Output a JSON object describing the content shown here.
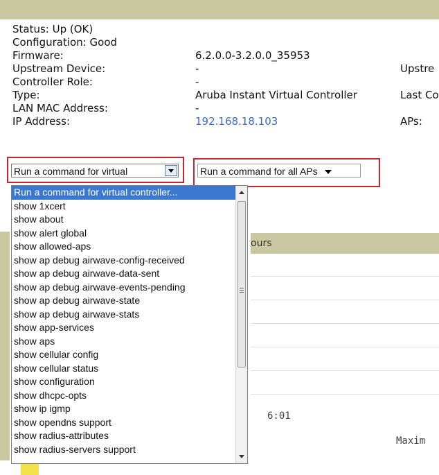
{
  "properties": [
    {
      "label": "Status: Up (OK)",
      "value": "",
      "extra": ""
    },
    {
      "label": "Configuration: Good",
      "value": "",
      "extra": ""
    },
    {
      "label": "Firmware:",
      "value": "6.2.0.0-3.2.0.0_35953",
      "extra": ""
    },
    {
      "label": "Upstream Device:",
      "value": "-",
      "extra": "Upstre"
    },
    {
      "label": "Controller Role:",
      "value": "-",
      "extra": ""
    },
    {
      "label": "Type:",
      "value": "Aruba Instant Virtual Controller",
      "extra": "Last Co"
    },
    {
      "label": "LAN MAC Address:",
      "value": "-",
      "extra": ""
    },
    {
      "label": "IP Address:",
      "value": "192.168.18.103",
      "extra": "APs:"
    }
  ],
  "commands": {
    "virtual_select_label": "Run a command for virtual",
    "all_aps_select_label": "Run a command for all APs"
  },
  "dropdown": {
    "selected_index": 0,
    "options": [
      "Run a command for virtual controller...",
      "show 1xcert",
      "show about",
      "show alert global",
      "show allowed-aps",
      "show ap debug airwave-config-received",
      "show ap debug airwave-data-sent",
      "show ap debug airwave-events-pending",
      "show ap debug airwave-state",
      "show ap debug airwave-stats",
      "show app-services",
      "show aps",
      "show cellular config",
      "show cellular status",
      "show configuration",
      "show dhcpc-opts",
      "show ip igmp",
      "show opendns support",
      "show radius-attributes",
      "show radius-servers support"
    ]
  },
  "panel": {
    "header_partial": "ours",
    "axis_time": "6:01",
    "footer_partial": "Maxim"
  },
  "colors": {
    "header_bg": "#c9c8a0",
    "highlight_red": "#c0282d",
    "selection_blue": "#3b78d0",
    "link_blue": "#3a6bc4"
  }
}
